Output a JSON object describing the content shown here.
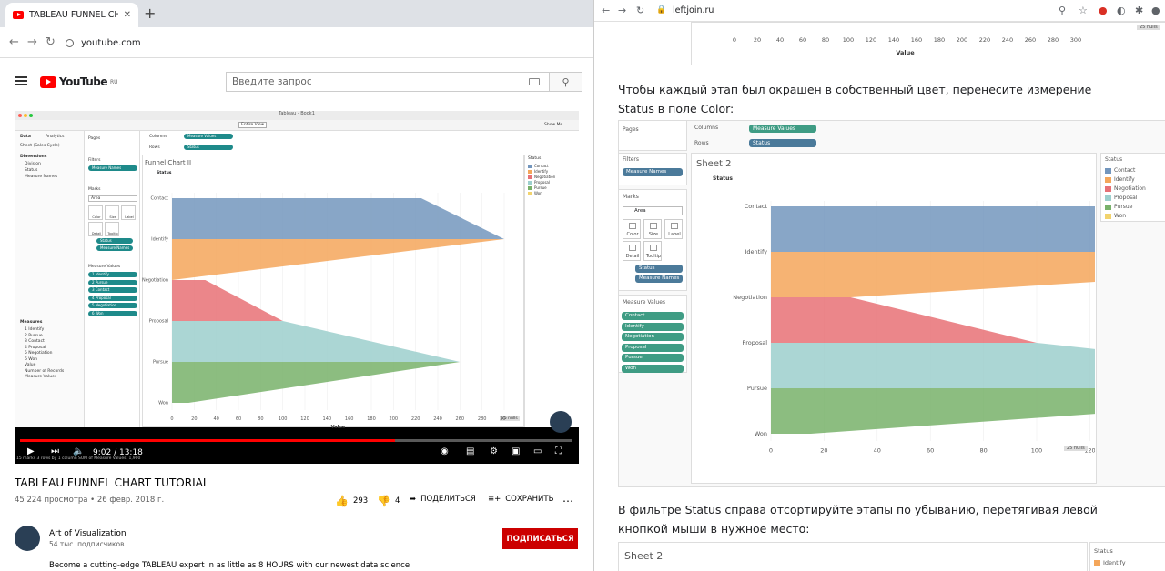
{
  "left_browser": {
    "tab_title": "TABLEAU FUNNEL CHART TUTORI",
    "url": "youtube.com",
    "logo_text": "YouTube",
    "logo_region": "RU",
    "search_placeholder": "Введите запрос"
  },
  "tableau_video": {
    "window_title": "Tableau - Book1",
    "entire_view": "Entire View",
    "show_me": "Show Me",
    "data_tab": "Data",
    "analytics_tab": "Analytics",
    "datasource": "Sheet (Sales Cycle)",
    "dimensions_header": "Dimensions",
    "dimensions": [
      "Division",
      "Status",
      "Measure Names"
    ],
    "measures_header": "Measures",
    "measures": [
      "1 Identify",
      "2 Pursue",
      "3 Contact",
      "4 Proposal",
      "5 Negotiation",
      "6 Won",
      "Value",
      "Number of Records",
      "Measure Values"
    ],
    "pages_label": "Pages",
    "filters_label": "Filters",
    "filter_pill": "Measure Names",
    "marks_label": "Marks",
    "mark_type": "Area",
    "mark_buttons": [
      "Color",
      "Size",
      "Label",
      "Detail",
      "Tooltip"
    ],
    "marks_pills": [
      "Status",
      "Measure Names"
    ],
    "measure_values_label": "Measure Values",
    "measure_values": [
      "1 Identify",
      "2 Pursue",
      "3 Contact",
      "4 Proposal",
      "5 Negotiation",
      "6 Won"
    ],
    "columns_label": "Columns",
    "rows_label": "Rows",
    "columns_pill": "Measure Values",
    "rows_pill": "Status",
    "sheet_title": "Funnel Chart II",
    "legend_title": "Status",
    "null_badge": "25 nulls",
    "status_bar": "15 marks   3 rows by 1 column   SUM of Measure Values: 1,900"
  },
  "player": {
    "time": "9:02 / 13:18",
    "progress": 0.68
  },
  "video": {
    "title": "TABLEAU FUNNEL CHART TUTORIAL",
    "meta": "45 224 просмотра • 26 февр. 2018 г.",
    "likes": "293",
    "dislikes": "4",
    "share": "ПОДЕЛИТЬСЯ",
    "save": "СОХРАНИТЬ",
    "channel": "Art of Visualization",
    "subscribers": "54 тыс. подписчиков",
    "subscribe": "ПОДПИСАТЬСЯ",
    "description": "Become a cutting-edge TABLEAU expert in as little as 8 HOURS with our newest data science"
  },
  "right_browser": {
    "url": "leftjoin.ru",
    "para1": "Чтобы каждый этап был окрашен в собственный цвет, перенесите измерение Status в поле Color:",
    "para2": "В фильтре Status справа отсортируйте этапы по убыванию, перетягивая левой кнопкой мыши в нужное место:",
    "pages_label": "Pages",
    "columns_label": "Columns",
    "rows_label": "Rows",
    "columns_pill": "Measure Values",
    "rows_pill": "Status",
    "filters_label": "Filters",
    "filter_pill": "Measure Names",
    "marks_label": "Marks",
    "mark_type": "Area",
    "mark_buttons": [
      "Color",
      "Size",
      "Label",
      "Detail",
      "Tooltip"
    ],
    "marks_pills": [
      "Status",
      "Measure Names"
    ],
    "measure_values_label": "Measure Values",
    "measure_values": [
      "Contact",
      "Identify",
      "Negotiation",
      "Proposal",
      "Pursue",
      "Won"
    ],
    "sheet_title": "Sheet 2",
    "legend_title": "Status",
    "null_badge": "25 nulls",
    "top_null_badge": "25 nulls",
    "sheet_title_2": "Sheet 2",
    "legend_title_2": "Status",
    "legend_item_2": "Identify",
    "top_axis_label": "Value"
  },
  "colors": {
    "Contact": "#7396bd",
    "Identify": "#f4a65a",
    "Negotiation": "#e77176",
    "Proposal": "#9ccfcd",
    "Pursue": "#78b16a",
    "Won": "#f2d36d"
  },
  "chart_data": [
    {
      "type": "area",
      "title": "Funnel Chart II",
      "xlabel": "Value",
      "ylabel": "Status",
      "categories": [
        "Contact",
        "Identify",
        "Negotiation",
        "Proposal",
        "Pursue",
        "Won"
      ],
      "x_ticks": [
        0,
        20,
        40,
        60,
        80,
        100,
        120,
        140,
        160,
        180,
        200,
        220,
        240,
        260,
        280,
        300
      ],
      "xlim": [
        0,
        300
      ],
      "series": [
        {
          "name": "Contact",
          "points": [
            [
              0,
              225
            ],
            [
              1,
              300
            ]
          ]
        },
        {
          "name": "Identify",
          "points": [
            [
              1,
              300
            ],
            [
              2,
              0
            ]
          ]
        },
        {
          "name": "Negotiation",
          "points": [
            [
              2,
              30
            ],
            [
              3,
              100
            ]
          ]
        },
        {
          "name": "Proposal",
          "points": [
            [
              3,
              100
            ],
            [
              4,
              260
            ]
          ]
        },
        {
          "name": "Pursue",
          "points": [
            [
              4,
              260
            ],
            [
              5,
              15
            ]
          ]
        }
      ],
      "legend": [
        "Contact",
        "Identify",
        "Negotiation",
        "Proposal",
        "Pursue",
        "Won"
      ]
    },
    {
      "type": "area",
      "title": "Sheet 2",
      "xlabel": "Value",
      "ylabel": "Status",
      "categories": [
        "Contact",
        "Identify",
        "Negotiation",
        "Proposal",
        "Pursue",
        "Won"
      ],
      "x_ticks": [
        0,
        20,
        40,
        60,
        80,
        100,
        120,
        140,
        160,
        180,
        200,
        220,
        240,
        260,
        280,
        300
      ],
      "xlim": [
        0,
        300
      ],
      "series": [
        {
          "name": "Contact",
          "points": [
            [
              0,
              225
            ],
            [
              1,
              300
            ]
          ]
        },
        {
          "name": "Identify",
          "points": [
            [
              1,
              300
            ],
            [
              2,
              30
            ]
          ]
        },
        {
          "name": "Negotiation",
          "points": [
            [
              2,
              30
            ],
            [
              3,
              100
            ]
          ]
        },
        {
          "name": "Proposal",
          "points": [
            [
              3,
              100
            ],
            [
              4,
              260
            ]
          ]
        },
        {
          "name": "Pursue",
          "points": [
            [
              4,
              260
            ],
            [
              5,
              15
            ]
          ]
        }
      ],
      "legend": [
        "Contact",
        "Identify",
        "Negotiation",
        "Proposal",
        "Pursue",
        "Won"
      ]
    }
  ]
}
